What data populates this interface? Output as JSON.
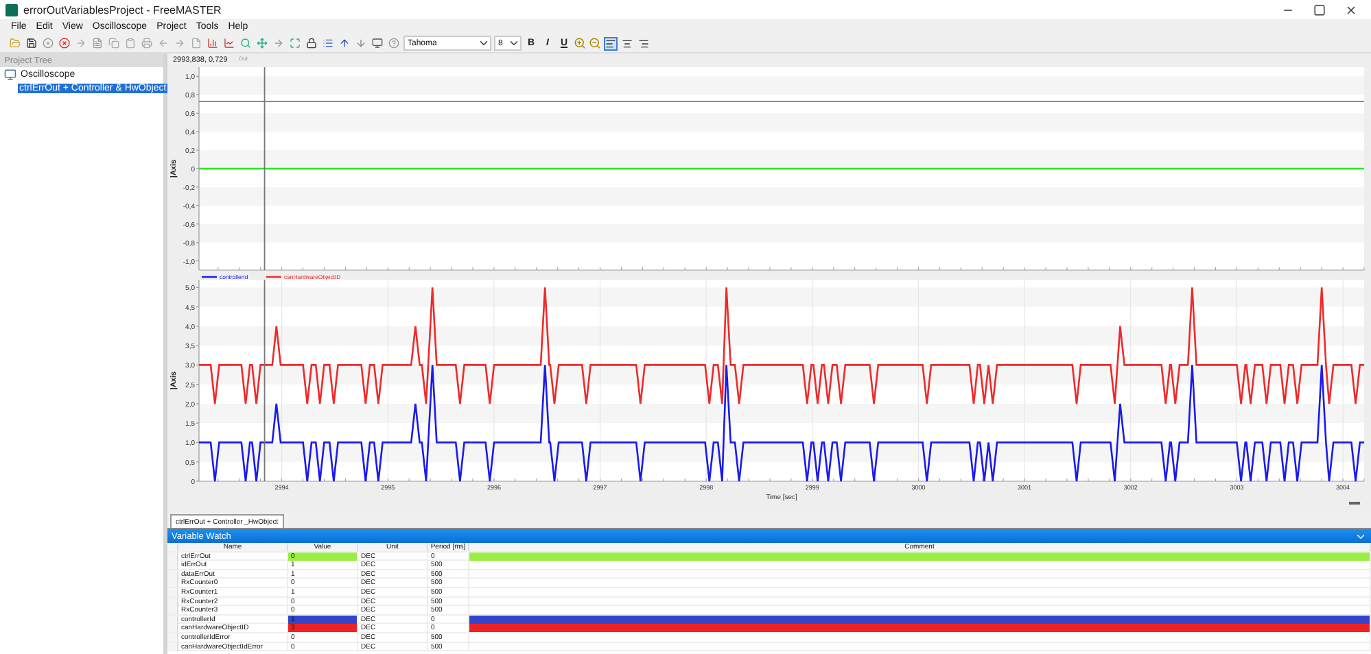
{
  "window": {
    "title": "errorOutVariablesProject - FreeMASTER"
  },
  "menu": [
    "File",
    "Edit",
    "View",
    "Oscilloscope",
    "Project",
    "Tools",
    "Help"
  ],
  "toolbar": {
    "font": "Tahoma",
    "size": "8",
    "format_buttons": [
      {
        "label": "B",
        "kind": "bold"
      },
      {
        "label": "I",
        "kind": "italic"
      },
      {
        "label": "U",
        "kind": "underline"
      }
    ],
    "align_buttons": [
      {
        "kind": "left",
        "pressed": true
      },
      {
        "kind": "center",
        "pressed": false
      },
      {
        "kind": "right",
        "pressed": false
      }
    ]
  },
  "project_tree": {
    "title": "Project Tree",
    "items": [
      {
        "label": "Oscilloscope",
        "selected": false,
        "children": [
          {
            "label": "ctrlErrOut + Controller & HwObject",
            "selected": true
          }
        ]
      }
    ]
  },
  "charts": [
    {
      "cursor_readout": "2993,838, 0,729",
      "legend_fragment": "Out",
      "chart_data": {
        "type": "line",
        "ylabel": "|Axis",
        "x": [
          2993.22,
          3004.2
        ],
        "xlim": [
          2993.22,
          3004.2
        ],
        "ylim": [
          -1.1,
          1.1
        ],
        "yticks": [
          {
            "value": 1,
            "label": "1,0"
          },
          {
            "value": 0.8,
            "label": "0,8"
          },
          {
            "value": 0.6,
            "label": "0,6"
          },
          {
            "value": 0.4,
            "label": "0,4"
          },
          {
            "value": 0.2,
            "label": "0,2"
          },
          {
            "value": 0,
            "label": "0"
          },
          {
            "value": -0.2,
            "label": "-0,2"
          },
          {
            "value": -0.4,
            "label": "-0,4"
          },
          {
            "value": -0.6,
            "label": "-0,6"
          },
          {
            "value": -0.8,
            "label": "-0,8"
          },
          {
            "value": -1,
            "label": "-1,0"
          }
        ],
        "series": [
          {
            "color": "#22ee22",
            "values": [
              0,
              0
            ]
          }
        ],
        "grid": true,
        "ref_lines": [
          {
            "axis": "x",
            "value": 2993.838
          },
          {
            "axis": "y",
            "value": 0.729
          }
        ]
      }
    },
    {
      "chart_data": {
        "type": "line",
        "ylabel": "|Axis",
        "xlabel": "Time [sec]",
        "xlim": [
          2993.22,
          3004.2
        ],
        "ylim": [
          0,
          5.2
        ],
        "x": [
          2993.22,
          2993.33,
          2993.37,
          2993.41,
          2993.62,
          2993.66,
          2993.7,
          2993.72,
          2993.76,
          2993.8,
          2993.91,
          2993.95,
          2993.99,
          2994.2,
          2994.24,
          2994.28,
          2994.32,
          2994.36,
          2994.4,
          2994.45,
          2994.49,
          2994.53,
          2994.75,
          2994.79,
          2994.83,
          2994.87,
          2994.91,
          2994.95,
          2995.22,
          2995.26,
          2995.3,
          2995.32,
          2995.36,
          2995.42,
          2995.46,
          2995.64,
          2995.68,
          2995.72,
          2995.92,
          2995.96,
          2996.0,
          2996.44,
          2996.48,
          2996.52,
          2996.53,
          2996.57,
          2996.61,
          2996.83,
          2996.87,
          2996.91,
          2997.34,
          2997.38,
          2997.42,
          2997.99,
          2998.03,
          2998.07,
          2998.11,
          2998.15,
          2998.19,
          2998.23,
          2998.27,
          2998.31,
          2998.35,
          2998.91,
          2998.95,
          2998.99,
          2999.01,
          2999.05,
          2999.09,
          2999.11,
          2999.15,
          2999.19,
          2999.23,
          2999.27,
          2999.31,
          2999.54,
          2999.58,
          2999.62,
          3000.04,
          3000.08,
          3000.12,
          3000.48,
          3000.52,
          3000.56,
          3000.58,
          3000.62,
          3000.66,
          3000.7,
          3000.74,
          3001.45,
          3001.49,
          3001.53,
          3001.81,
          3001.85,
          3001.9,
          3001.94,
          3002.29,
          3002.33,
          3002.37,
          3002.38,
          3002.42,
          3002.46,
          3002.54,
          3002.58,
          3002.62,
          3003.0,
          3003.04,
          3003.08,
          3003.09,
          3003.13,
          3003.17,
          3003.24,
          3003.28,
          3003.32,
          3003.41,
          3003.45,
          3003.49,
          3003.53,
          3003.57,
          3003.61,
          3003.76,
          3003.8,
          3003.84,
          3003.87,
          3003.91,
          3004.08,
          3004.12,
          3004.16,
          3004.2
        ],
        "xticks": [
          2994,
          2995,
          2996,
          2997,
          2998,
          2999,
          3000,
          3001,
          3002,
          3003,
          3004
        ],
        "yticks": [
          {
            "value": 5,
            "label": "5,0"
          },
          {
            "value": 4.5,
            "label": "4,5"
          },
          {
            "value": 4,
            "label": "4,0"
          },
          {
            "value": 3.5,
            "label": "3,5"
          },
          {
            "value": 3,
            "label": "3,0"
          },
          {
            "value": 2.5,
            "label": "2,5"
          },
          {
            "value": 2,
            "label": "2,0"
          },
          {
            "value": 1.5,
            "label": "1,5"
          },
          {
            "value": 1,
            "label": "1,0"
          },
          {
            "value": 0.5,
            "label": "0,5"
          },
          {
            "value": 0,
            "label": "0"
          }
        ],
        "series": [
          {
            "name": "controllerId",
            "color": "#1a1aee",
            "values": [
              1,
              1,
              0,
              1,
              1,
              0,
              1,
              1,
              0,
              1,
              1,
              2,
              1,
              1,
              0,
              1,
              1,
              0,
              1,
              1,
              0,
              1,
              1,
              0,
              1,
              1,
              0,
              1,
              1,
              2,
              1,
              1,
              0,
              3,
              1,
              1,
              0,
              1,
              1,
              0,
              1,
              1,
              3,
              1,
              1,
              0,
              1,
              1,
              0,
              1,
              1,
              0,
              1,
              1,
              0,
              1,
              1,
              0,
              3,
              1,
              1,
              0,
              1,
              1,
              0,
              1,
              1,
              0,
              1,
              1,
              0,
              1,
              1,
              0,
              1,
              1,
              0,
              1,
              1,
              0,
              1,
              1,
              0,
              1,
              1,
              0,
              1,
              0,
              1,
              1,
              0,
              1,
              1,
              0,
              2,
              1,
              1,
              0,
              1,
              1,
              0,
              1,
              1,
              3,
              1,
              1,
              0,
              1,
              1,
              0,
              1,
              1,
              0,
              1,
              1,
              0,
              1,
              1,
              0,
              1,
              1,
              3,
              1,
              0,
              1,
              1,
              0,
              1,
              1
            ]
          },
          {
            "name": "canHardwareObjectID",
            "color": "#ee2a2a",
            "values": [
              3,
              3,
              2,
              3,
              3,
              2,
              3,
              3,
              2,
              3,
              3,
              4,
              3,
              3,
              2,
              3,
              3,
              2,
              3,
              3,
              2,
              3,
              3,
              2,
              3,
              3,
              2,
              3,
              3,
              4,
              3,
              3,
              2,
              5,
              3,
              3,
              2,
              3,
              3,
              2,
              3,
              3,
              5,
              3,
              3,
              2,
              3,
              3,
              2,
              3,
              3,
              2,
              3,
              3,
              2,
              3,
              3,
              2,
              5,
              3,
              3,
              2,
              3,
              3,
              2,
              3,
              3,
              2,
              3,
              3,
              2,
              3,
              3,
              2,
              3,
              3,
              2,
              3,
              3,
              2,
              3,
              3,
              2,
              3,
              3,
              2,
              3,
              2,
              3,
              3,
              2,
              3,
              3,
              2,
              4,
              3,
              3,
              2,
              3,
              3,
              2,
              3,
              3,
              5,
              3,
              3,
              2,
              3,
              3,
              2,
              3,
              3,
              2,
              3,
              3,
              2,
              3,
              3,
              2,
              3,
              3,
              5,
              3,
              2,
              3,
              3,
              2,
              3,
              3
            ]
          }
        ],
        "grid": true,
        "ref_lines": [
          {
            "axis": "x",
            "value": 2993.838
          }
        ]
      }
    }
  ],
  "chart_tab": {
    "label": "ctrlErrOut + Controller _HwObject",
    "selected": true
  },
  "variable_watch": {
    "title": "Variable Watch",
    "columns": [
      "Name",
      "Value",
      "Unit",
      "Period [ms]",
      "Comment"
    ],
    "rows": [
      {
        "name": "ctrlErrOut",
        "value": "0",
        "unit": "DEC",
        "period": "0",
        "color": "#99ee44"
      },
      {
        "name": "idErrOut",
        "value": "1",
        "unit": "DEC",
        "period": "500"
      },
      {
        "name": "dataErrOut",
        "value": "1",
        "unit": "DEC",
        "period": "500"
      },
      {
        "name": "RxCounter0",
        "value": "0",
        "unit": "DEC",
        "period": "500"
      },
      {
        "name": "RxCounter1",
        "value": "1",
        "unit": "DEC",
        "period": "500"
      },
      {
        "name": "RxCounter2",
        "value": "0",
        "unit": "DEC",
        "period": "500"
      },
      {
        "name": "RxCounter3",
        "value": "0",
        "unit": "DEC",
        "period": "500"
      },
      {
        "name": "controllerId",
        "value": "1",
        "unit": "DEC",
        "period": "0",
        "color": "#3344cc"
      },
      {
        "name": "canHardwareObjectID",
        "value": "3",
        "unit": "DEC",
        "period": "0",
        "color": "#ee2222"
      },
      {
        "name": "controllerIdError",
        "value": "0",
        "unit": "DEC",
        "period": "500"
      },
      {
        "name": "canHardwareObjectIdError",
        "value": "0",
        "unit": "DEC",
        "period": "500"
      }
    ]
  }
}
